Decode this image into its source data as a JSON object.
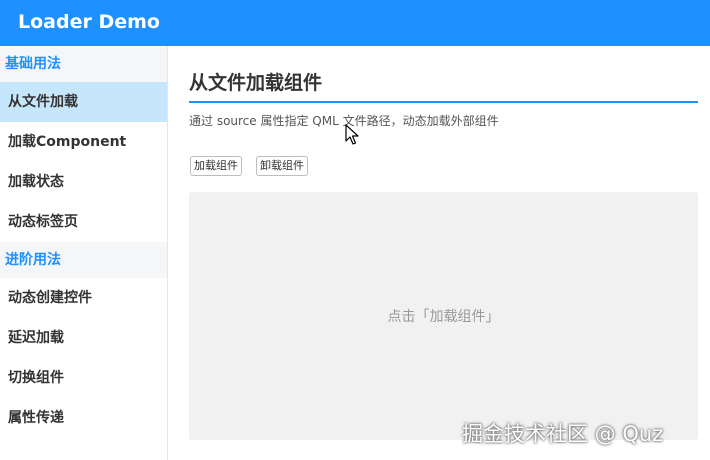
{
  "window": {
    "title": "Loader Demo"
  },
  "sidebar": {
    "groups": [
      {
        "label": "基础用法",
        "items": [
          "从文件加载",
          "加载Component",
          "加载状态",
          "动态标签页"
        ]
      },
      {
        "label": "进阶用法",
        "items": [
          "动态创建控件",
          "延迟加载",
          "切换组件",
          "属性传递"
        ]
      }
    ],
    "active_item": "从文件加载"
  },
  "main": {
    "title": "从文件加载组件",
    "description": "通过 source 属性指定 QML 文件路径，动态加载外部组件",
    "buttons": {
      "load": "加载组件",
      "unload": "卸载组件"
    },
    "placeholder": "点击「加载组件」"
  },
  "watermark": "掘金技术社区 @ Quz",
  "colors": {
    "accent": "#1e90ff",
    "active_bg": "#c6e6fc"
  }
}
